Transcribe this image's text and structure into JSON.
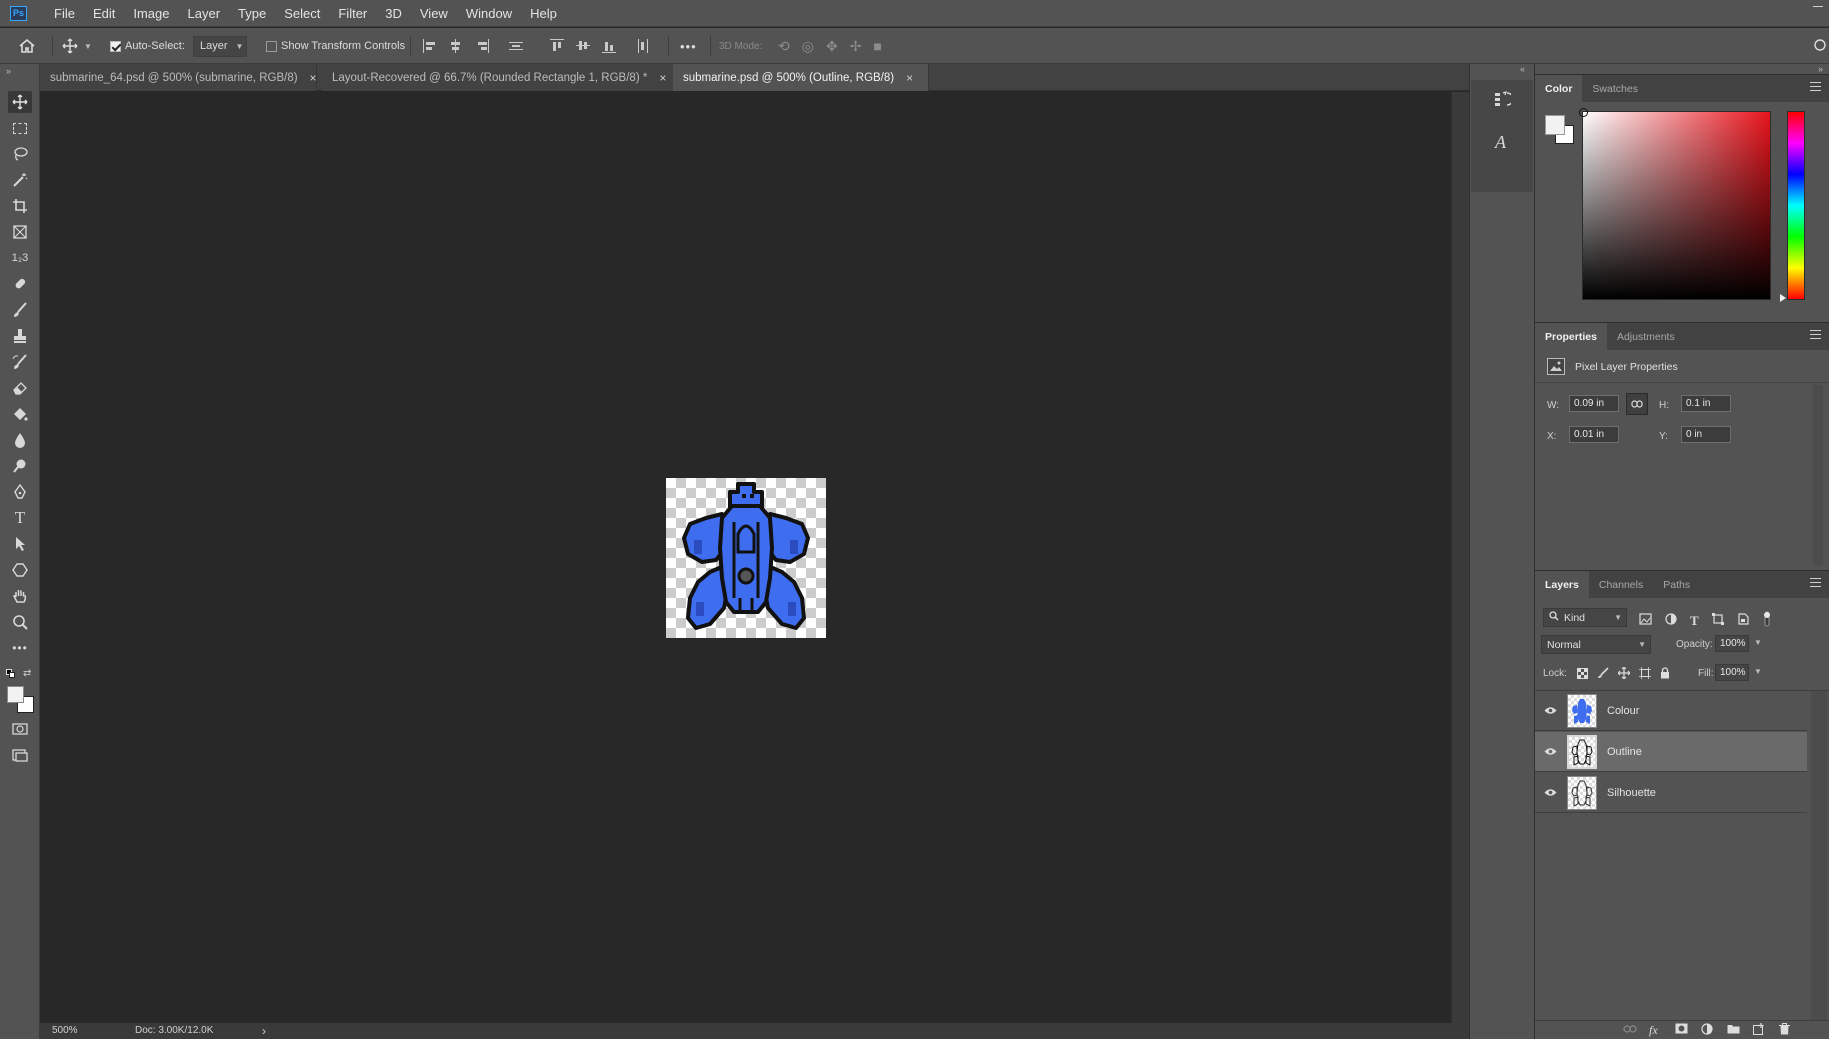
{
  "app": {
    "logo": "Ps"
  },
  "menu": [
    "File",
    "Edit",
    "Image",
    "Layer",
    "Type",
    "Select",
    "Filter",
    "3D",
    "View",
    "Window",
    "Help"
  ],
  "options": {
    "auto_select_label": "Auto-Select:",
    "auto_select_checked": true,
    "auto_select_target": "Layer",
    "show_transform_label": "Show Transform Controls",
    "show_transform_checked": false,
    "more": "•••",
    "mode_3d_label": "3D Mode:"
  },
  "tabs": [
    {
      "label": "submarine_64.psd @ 500% (submarine, RGB/8)",
      "close": "×",
      "active": false
    },
    {
      "label": "Layout-Recovered @ 66.7% (Rounded Rectangle 1, RGB/8) *",
      "close": "×",
      "active": false
    },
    {
      "label": "submarine.psd @ 500% (Outline, RGB/8)",
      "close": "×",
      "active": true
    }
  ],
  "status": {
    "zoom": "500%",
    "doc": "Doc: 3.00K/12.0K",
    "arrow": "›"
  },
  "color_panel": {
    "tabs": [
      "Color",
      "Swatches"
    ],
    "foreground": "#f2f2f2",
    "background": "#ffffff",
    "hue_color": "#e8141c"
  },
  "properties_panel": {
    "tabs": [
      "Properties",
      "Adjustments"
    ],
    "heading": "Pixel Layer Properties",
    "w_label": "W:",
    "w_value": "0.09 in",
    "h_label": "H:",
    "h_value": "0.1 in",
    "x_label": "X:",
    "x_value": "0.01 in",
    "y_label": "Y:",
    "y_value": "0 in"
  },
  "layers_panel": {
    "tabs": [
      "Layers",
      "Channels",
      "Paths"
    ],
    "filter_kind": "Kind",
    "blend_mode": "Normal",
    "opacity_label": "Opacity:",
    "opacity_value": "100%",
    "lock_label": "Lock:",
    "fill_label": "Fill:",
    "fill_value": "100%",
    "layers": [
      {
        "name": "Colour",
        "visible": true,
        "selected": false
      },
      {
        "name": "Outline",
        "visible": true,
        "selected": true
      },
      {
        "name": "Silhouette",
        "visible": true,
        "selected": false
      }
    ],
    "footer_icons": [
      "link-icon",
      "fx-icon",
      "mask-icon",
      "adjustment-icon",
      "group-icon",
      "new-layer-icon",
      "trash-icon"
    ],
    "fx_label": "fx"
  },
  "colors": {
    "submarine_blue": "#3f6df0",
    "outline": "#111111",
    "ui_bg": "#535353",
    "canvas_bg": "#282828"
  }
}
